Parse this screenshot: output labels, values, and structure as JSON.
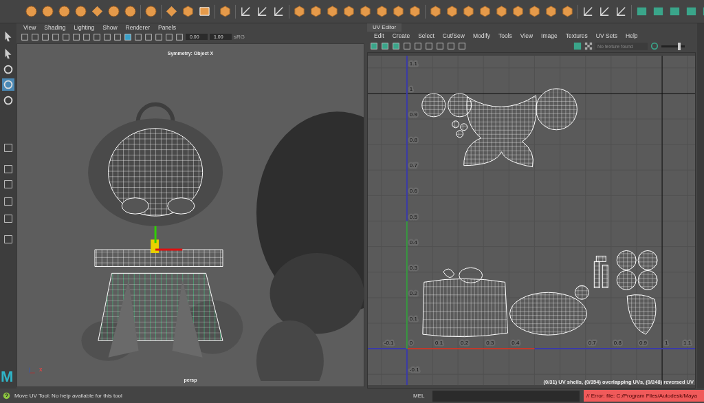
{
  "viewport": {
    "menu": [
      "View",
      "Shading",
      "Lighting",
      "Show",
      "Renderer",
      "Panels"
    ],
    "fields": [
      "0.00",
      "1.00"
    ],
    "color_space": "sRG",
    "symmetry": "Symmetry: Object X",
    "camera": "persp",
    "axis_label": "x"
  },
  "uv_editor": {
    "tab": "UV Editor",
    "menu": [
      "Edit",
      "Create",
      "Select",
      "Cut/Sew",
      "Modify",
      "Tools",
      "View",
      "Image",
      "Textures",
      "UV Sets",
      "Help"
    ],
    "texture_field": {
      "placeholder": "No texture found"
    },
    "exposure": {
      "level": 0.75
    },
    "u_labels": [
      "-0.1",
      "0",
      "0.1",
      "0.2",
      "0.3",
      "0.4",
      "0.7",
      "0.8",
      "0.9",
      "1",
      "1.1"
    ],
    "v_labels": [
      "1.1",
      "1",
      "0.9",
      "0.8",
      "0.7",
      "0.6",
      "0.5",
      "0.4",
      "0.3",
      "0.2",
      "0.1",
      "-0.1"
    ],
    "status": "(0/31) UV shells, (0/354) overlapping UVs, (0/248) reversed UV"
  },
  "logo": "M",
  "help_line": "Move UV Tool: No help available for this tool",
  "command_line": {
    "label": "MEL",
    "error": "// Error: file: C:/Program Files/Autodesk/Maya"
  }
}
